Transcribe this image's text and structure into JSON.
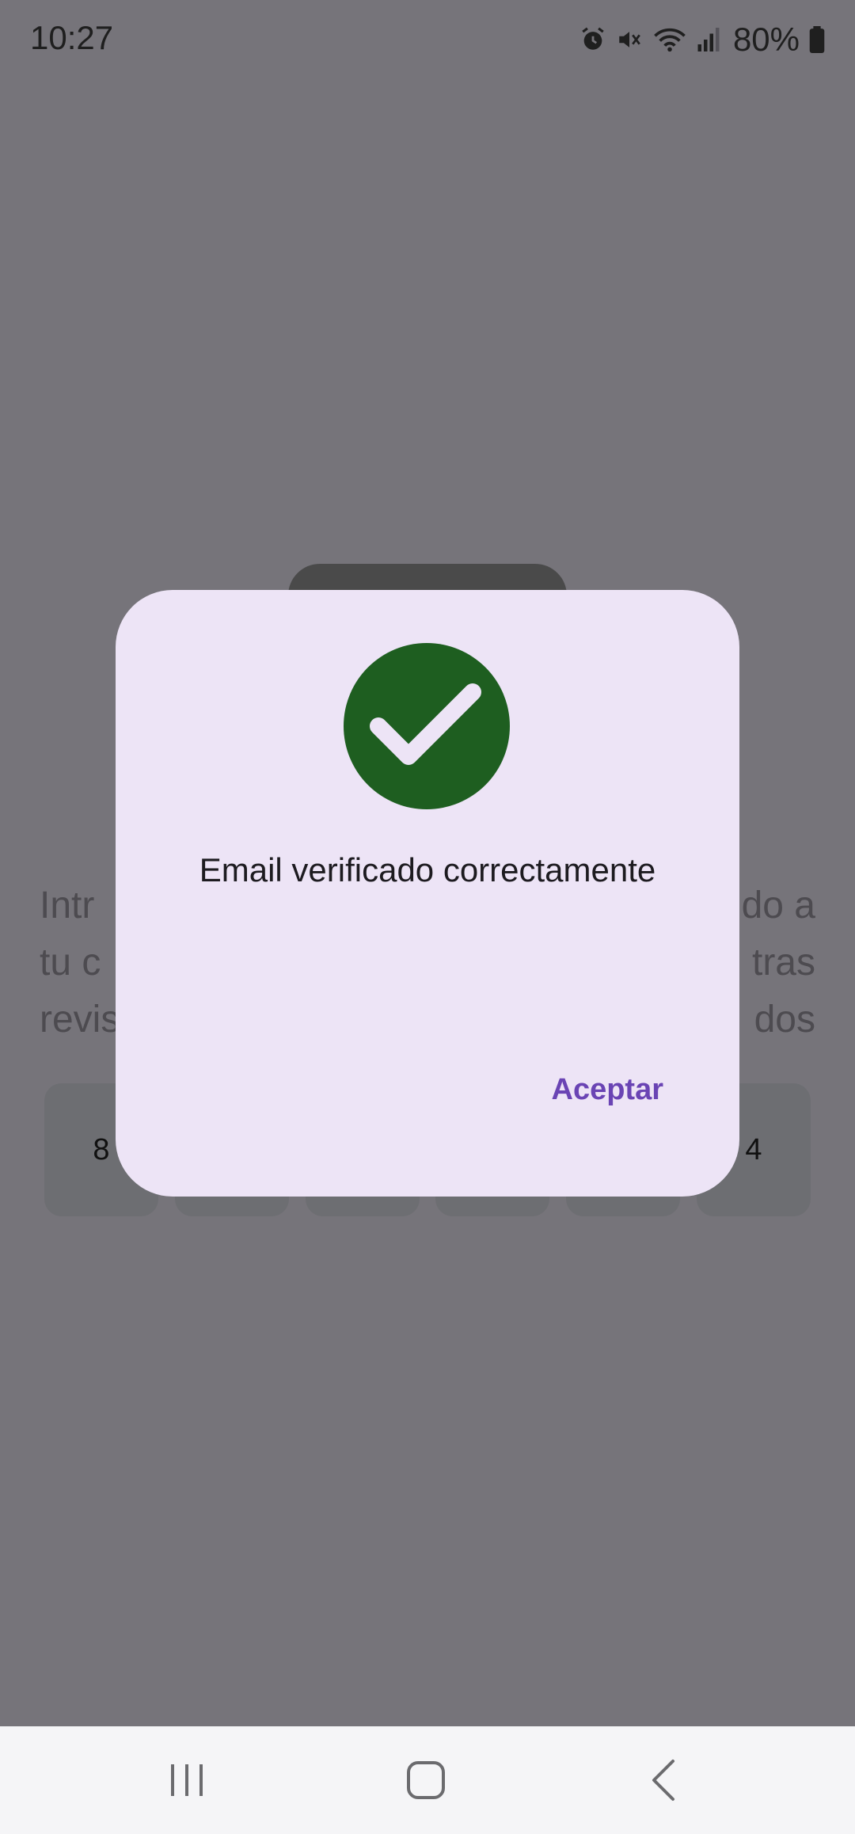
{
  "status_bar": {
    "time": "10:27",
    "battery": "80%",
    "icons": [
      "alarm-icon",
      "mute-icon",
      "wifi-icon",
      "signal-icon",
      "battery-icon"
    ]
  },
  "background": {
    "instructions_line1_left": "Intr",
    "instructions_line1_right": "do a",
    "instructions_line2_left": "tu c",
    "instructions_line2_right": "tras",
    "instructions_line3_left": "revis",
    "instructions_line3_right": "dos",
    "code_digits": [
      "8",
      "",
      "",
      "",
      "",
      "4"
    ]
  },
  "dialog": {
    "icon": "check-circle-icon",
    "icon_color": "#1e5e20",
    "message": "Email verificado correctamente",
    "accept_label": "Aceptar",
    "accent_color": "#6a44b4"
  },
  "nav_bar": {
    "items": [
      "recents-icon",
      "home-icon",
      "back-icon"
    ]
  }
}
